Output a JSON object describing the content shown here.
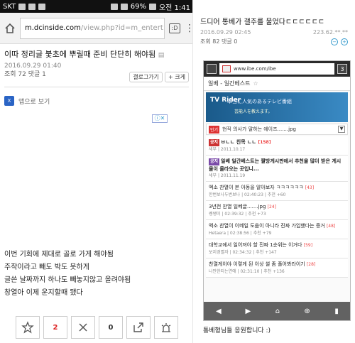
{
  "status": {
    "carrier": "SKT",
    "battery": "69%",
    "time": "오전 1:41"
  },
  "browser": {
    "domain": "m.dcinside.com",
    "path": "/view.php?id=m_entert",
    "tab_icon": "tab-icon"
  },
  "post": {
    "title": "이따 정리글 붗초에 뿌릴때 준비 단단히 해야됨",
    "date": "2016.09.29 01:40",
    "views": "조회 72 댓글 1",
    "gallery_btn": "갤로그가기",
    "zoom_btn": "+ 크게",
    "app_view": "앱으로 보기",
    "body_lines": [
      "이번 기회에 제대로 골로 가게 해야됨",
      "주작이라고 빼도 박도 못하게",
      "글쓴 날짜까지 하나도 빼놓지않고 올려야됨",
      "창열아 이제 운지할때 됐다"
    ],
    "recommend": "2",
    "unrecommend": "0"
  },
  "right": {
    "title": "드디어 통베가 갤주를 물었다ㄷㄷㄷㄷㄷㄷ",
    "date": "2016.09.29 02:45",
    "ip": "223.62.**.**",
    "views": "조회 82 댓글 0",
    "inner_url": "www.ibe.com/ibe",
    "inner_tabs": "3",
    "section": "일베 - 일간베스트",
    "banner_title": "TV Rider",
    "banner_sub": "本当に人気のあるテレビ番組",
    "banner_sub2": "芸能人を教えます。",
    "hot_tag": "인기",
    "hot_text": "현직 의사가 말하는 에이즈.......jpg",
    "items": [
      {
        "label": "공지",
        "title": "ㅂㄴㄴ 친목 ㄴㄴ",
        "count": "[158]",
        "author": "세부",
        "date": "2011.10.17",
        "rec": ""
      },
      {
        "label": "공지",
        "title": "일베 일간베스트는 짤방게시판에서 추천을 많이 받은 게시물이 올라오는 곳입니...",
        "count": "",
        "author": "세부",
        "date": "2011.11.19",
        "rec": ""
      },
      {
        "label": "",
        "title": "엑소 찬열이 본 아동을 알아보자 ㅋㅋㅋㅋㅋㅋ",
        "count": "[43]",
        "author": "한번보나두번보나",
        "date": "02:40:23",
        "rec": "추천 +60"
      },
      {
        "label": "",
        "title": "3년전 찬열 일베글.......jpg",
        "count": "[24]",
        "author": "쌩쌩이",
        "date": "02:39:32",
        "rec": "추천 +73"
      },
      {
        "label": "",
        "title": "엑소 찬열이 이메일 도움이 아니라 진짜 가입했다는 증거",
        "count": "[48]",
        "author": "Hetaera",
        "date": "02:38:56",
        "rec": "추천 +79"
      },
      {
        "label": "",
        "title": "대학교에서 일어져야 할 진짜 1순위는 이거다",
        "count": "[59]",
        "author": "보지경멸자",
        "date": "02:34:32",
        "rec": "추천 +147"
      },
      {
        "label": "",
        "title": "찬열게이야 이렇게 된 이상 썰 좀 풀어봐라이기",
        "count": "[28]",
        "author": "나만한되는연애",
        "date": "02:31:10",
        "rec": "추천 +136"
      }
    ],
    "footer": "통베형님들 응원합니다 :)"
  }
}
